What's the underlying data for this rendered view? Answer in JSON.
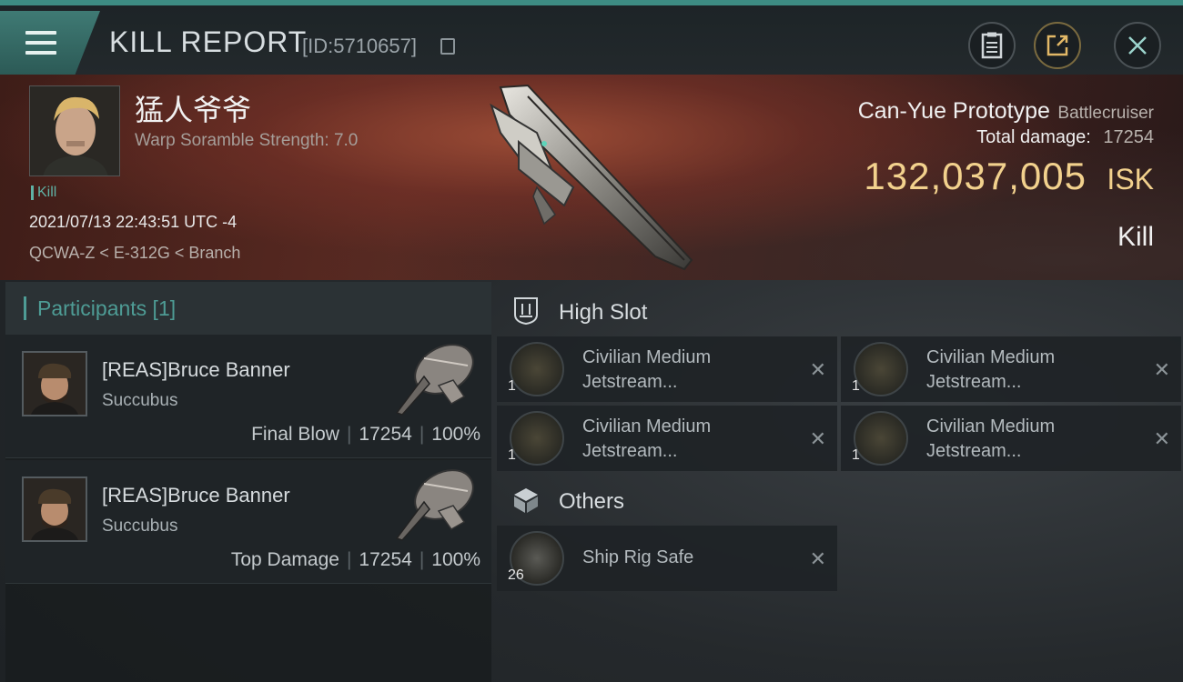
{
  "header": {
    "title": "KILL REPORT",
    "report_id": "[ID:5710657]",
    "icons": [
      "menu-icon",
      "copy-icon",
      "clipboard-icon",
      "share-icon",
      "close-icon"
    ]
  },
  "victim": {
    "name": "猛人爷爷",
    "warp_strength": "Warp Soramble Strength: 7.0",
    "tag": "Kill",
    "timestamp": "2021/07/13 22:43:51 UTC -4",
    "location": "QCWA-Z < E-312G < Branch",
    "ship_name": "Can-Yue Prototype",
    "ship_class": "Battlecruiser",
    "total_damage_label": "Total damage:",
    "total_damage_value": "17254",
    "isk_value": "132,037,005",
    "isk_unit": "ISK",
    "result": "Kill"
  },
  "participants": {
    "title": "Participants [1]",
    "rows": [
      {
        "name": "[REAS]Bruce Banner",
        "ship": "Succubus",
        "role": "Final Blow",
        "damage": "17254",
        "percent": "100%"
      },
      {
        "name": "[REAS]Bruce Banner",
        "ship": "Succubus",
        "role": "Top Damage",
        "damage": "17254",
        "percent": "100%"
      }
    ]
  },
  "high_slot": {
    "title": "High Slot",
    "items": [
      {
        "name": "Civilian Medium Jetstream...",
        "qty": "1"
      },
      {
        "name": "Civilian Medium Jetstream...",
        "qty": "1"
      },
      {
        "name": "Civilian Medium Jetstream...",
        "qty": "1"
      },
      {
        "name": "Civilian Medium Jetstream...",
        "qty": "1"
      }
    ]
  },
  "others": {
    "title": "Others",
    "items": [
      {
        "name": "Ship Rig Safe",
        "qty": "26"
      }
    ]
  },
  "colors": {
    "accent_teal": "#4e9c95",
    "isk_gold": "#f2d18d",
    "banner_red": "#5a2a22"
  }
}
